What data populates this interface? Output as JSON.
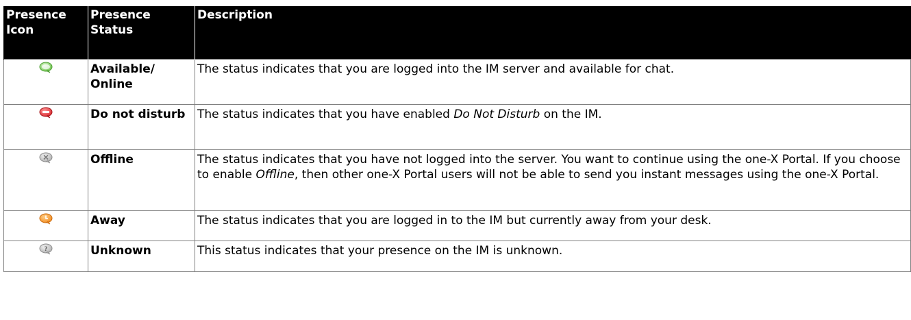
{
  "header": {
    "col1": "Presence Icon",
    "col2": "Presence Status",
    "col3": "Description"
  },
  "rows": [
    {
      "icon": "available-bubble-icon",
      "icon_color": "#6cc24a",
      "status": "Available/ Online",
      "description": "The status indicates that you are logged into the IM server and available for chat."
    },
    {
      "icon": "do-not-disturb-bubble-icon",
      "icon_color": "#d9262c",
      "status": "Do not disturb",
      "description_before": "The status indicates that you have enabled ",
      "description_em": "Do Not Disturb",
      "description_after": " on the IM."
    },
    {
      "icon": "offline-bubble-icon",
      "icon_color": "#b0b0b0",
      "status": "Offline",
      "description_before": "The status indicates that you have not logged into the server. You want to continue using the one-X Portal. If you choose to enable ",
      "description_em": "Offline",
      "description_after": ", then other one-X Portal users will not be able to send you instant messages using the one-X Portal."
    },
    {
      "icon": "away-bubble-icon",
      "icon_color": "#f28a1e",
      "status": "Away",
      "description": "The status indicates that you are logged in to the IM but currently away from your desk."
    },
    {
      "icon": "unknown-bubble-icon",
      "icon_color": "#b0b0b0",
      "status": "Unknown",
      "description": "This status indicates that your presence on the IM is unknown."
    }
  ]
}
